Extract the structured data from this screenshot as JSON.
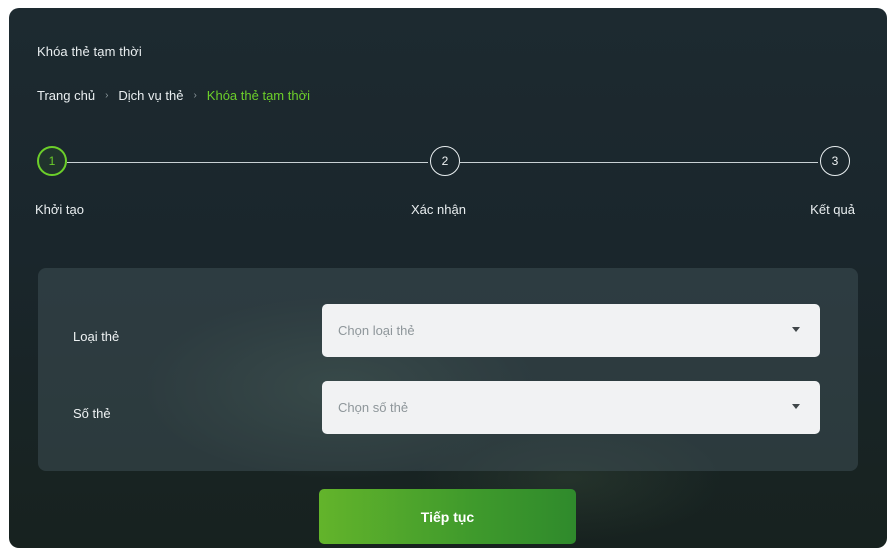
{
  "page": {
    "title": "Khóa thẻ tạm thời"
  },
  "breadcrumb": {
    "items": [
      {
        "label": "Trang chủ"
      },
      {
        "label": "Dịch vụ thẻ"
      },
      {
        "label": "Khóa thẻ tạm thời"
      }
    ],
    "separator": "›"
  },
  "stepper": {
    "current_step": 1,
    "steps": [
      {
        "number": "1",
        "label": "Khởi tạo"
      },
      {
        "number": "2",
        "label": "Xác nhận"
      },
      {
        "number": "3",
        "label": "Kết quả"
      }
    ]
  },
  "form": {
    "card_type": {
      "label": "Loại thẻ",
      "placeholder": "Chọn loại thẻ"
    },
    "card_number": {
      "label": "Số thẻ",
      "placeholder": "Chọn số thẻ"
    }
  },
  "actions": {
    "continue_label": "Tiếp tục"
  },
  "colors": {
    "accent": "#6ccf2a",
    "background": "#1d2a30",
    "button": "#4fa72b"
  }
}
